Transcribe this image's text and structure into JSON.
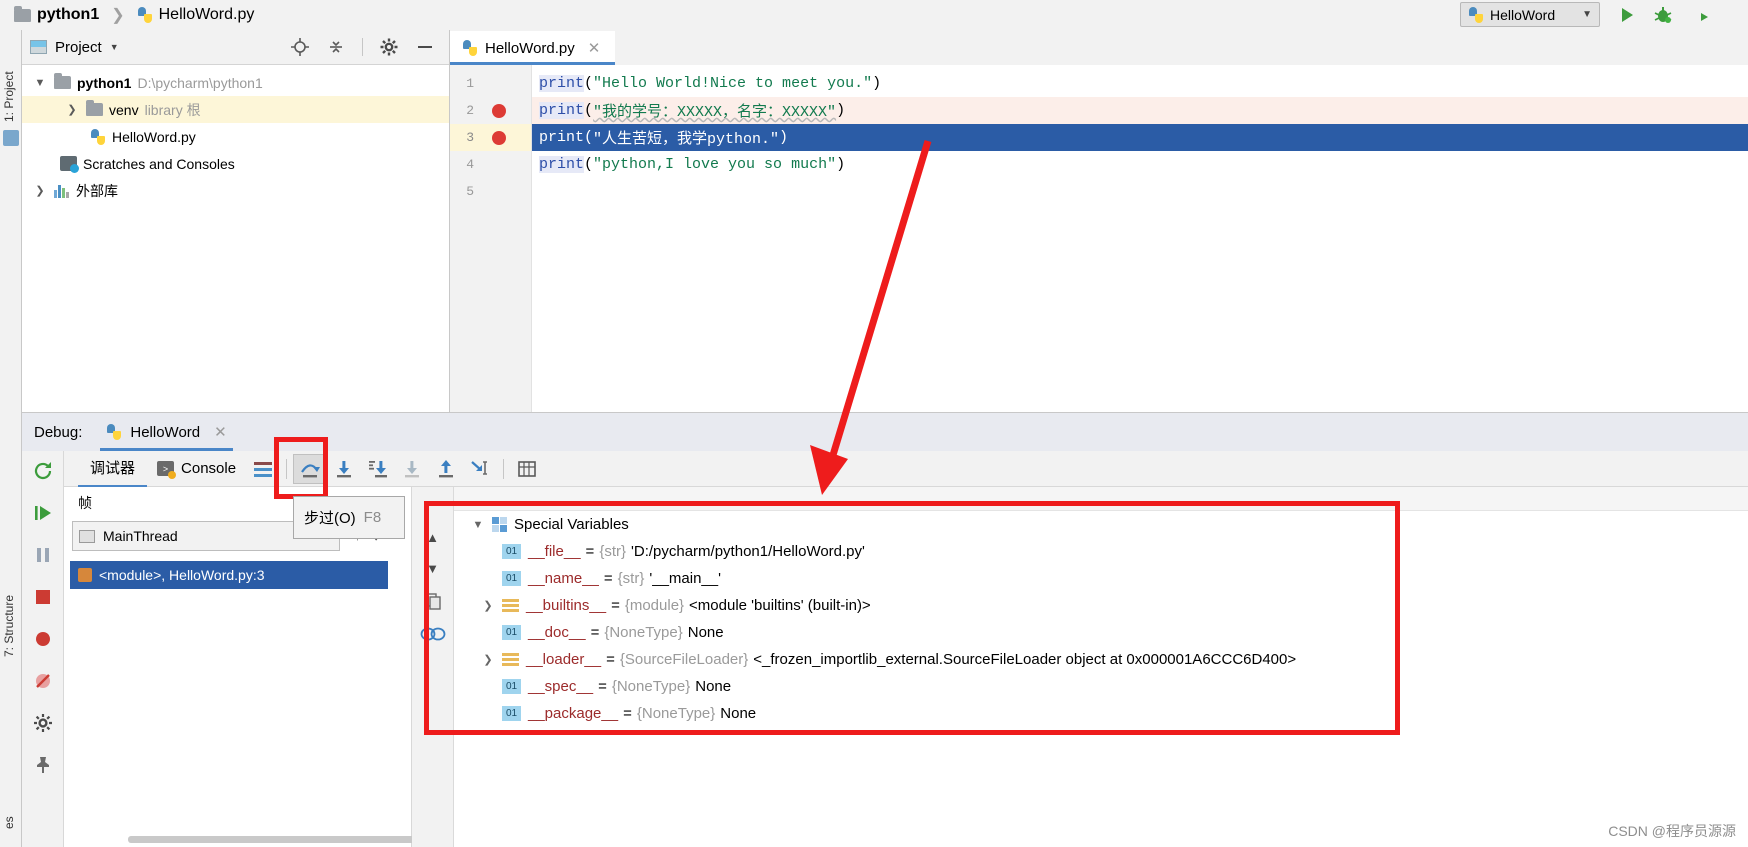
{
  "breadcrumb": {
    "project": "python1",
    "file": "HelloWord.py"
  },
  "toolbar": {
    "run_config": "HelloWord",
    "run_label": "run-button",
    "debug_label": "debug-button",
    "run_coverage_label": "run-with-coverage-button"
  },
  "left_strip": {
    "project_tab": "1: Project",
    "structure_tab": "7: Structure",
    "favorites_tab": "es"
  },
  "project_panel": {
    "title": "Project",
    "tree": [
      {
        "label": "python1",
        "detail": "D:\\pycharm\\python1",
        "indent": 0,
        "arrow": "v",
        "icon": "folder-icon",
        "bold": true,
        "selected": false
      },
      {
        "label": "venv",
        "detail": "library 根",
        "indent": 1,
        "arrow": ">",
        "icon": "folder-icon",
        "bold": false,
        "selected": true
      },
      {
        "label": "HelloWord.py",
        "detail": "",
        "indent": 2,
        "arrow": "",
        "icon": "python-file-icon",
        "bold": false,
        "selected": false
      },
      {
        "label": "Scratches and Consoles",
        "detail": "",
        "indent": 0,
        "arrow": "",
        "icon": "scratches-icon",
        "bold": false,
        "selected": false
      },
      {
        "label": "外部库",
        "detail": "",
        "indent": 0,
        "arrow": ">",
        "icon": "library-icon",
        "bold": false,
        "selected": false
      }
    ]
  },
  "editor": {
    "tab_title": "HelloWord.py",
    "lines": [
      {
        "n": "1",
        "breakpoint": false,
        "state": "normal",
        "func": "print",
        "open": "(",
        "string": "\"Hello World!Nice to meet you.\"",
        "close": ")"
      },
      {
        "n": "2",
        "breakpoint": true,
        "state": "warn",
        "func": "print",
        "open": "(",
        "string": "\"我的学号：XXXXX，名字：XXXXX\"",
        "close": ")"
      },
      {
        "n": "3",
        "breakpoint": true,
        "state": "current",
        "func": "print",
        "open": "(",
        "string": "\"人生苦短，我学python.\"",
        "close": ")"
      },
      {
        "n": "4",
        "breakpoint": false,
        "state": "normal",
        "func": "print",
        "open": "(",
        "string": "\"python,I love you so much\"",
        "close": ")"
      },
      {
        "n": "5",
        "breakpoint": false,
        "state": "normal",
        "func": "",
        "open": "",
        "string": "",
        "close": ""
      }
    ]
  },
  "debug": {
    "label": "Debug:",
    "session_tab": "HelloWord",
    "tabs": {
      "debugger": "调试器",
      "console": "Console"
    },
    "frames": {
      "title": "帧",
      "thread": "MainThread",
      "frame": "<module>, HelloWord.py:3"
    },
    "tooltip": {
      "text": "步过(O)",
      "key": "F8"
    },
    "variables": [
      {
        "expand": "v",
        "icon": "special-variables-icon",
        "name": "Special Variables",
        "type": "",
        "value": "",
        "indent": 0
      },
      {
        "expand": "",
        "icon": "primitive-icon",
        "name": "__file__",
        "type": "{str}",
        "value": "'D:/pycharm/python1/HelloWord.py'",
        "indent": 1
      },
      {
        "expand": "",
        "icon": "primitive-icon",
        "name": "__name__",
        "type": "{str}",
        "value": "'__main__'",
        "indent": 1
      },
      {
        "expand": ">",
        "icon": "module-icon",
        "name": "__builtins__",
        "type": "{module}",
        "value": "<module 'builtins' (built-in)>",
        "indent": 1
      },
      {
        "expand": "",
        "icon": "primitive-icon",
        "name": "__doc__",
        "type": "{NoneType}",
        "value": "None",
        "indent": 1
      },
      {
        "expand": ">",
        "icon": "module-icon",
        "name": "__loader__",
        "type": "{SourceFileLoader}",
        "value": "<_frozen_importlib_external.SourceFileLoader object at 0x000001A6CCC6D400>",
        "indent": 1
      },
      {
        "expand": "",
        "icon": "primitive-icon",
        "name": "__spec__",
        "type": "{NoneType}",
        "value": "None",
        "indent": 1
      },
      {
        "expand": "",
        "icon": "primitive-icon",
        "name": "__package__",
        "type": "{NoneType}",
        "value": "None",
        "indent": 1
      }
    ]
  },
  "watermark": "CSDN @程序员源源",
  "colors": {
    "accent_blue": "#4a86c8",
    "selection_blue": "#2b5ca6",
    "annotation_red": "#ee1c1c",
    "breakpoint_red": "#dd3b35",
    "string_green": "#127a4e",
    "keyword_blue": "#2d4ea8"
  }
}
